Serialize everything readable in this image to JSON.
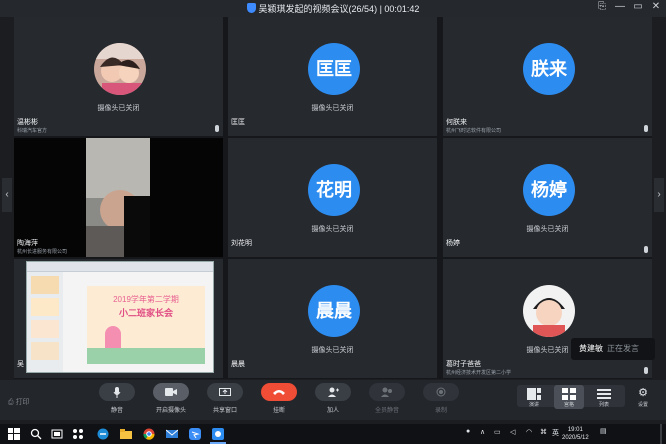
{
  "window": {
    "title": "吴颖琪发起的视频会议(26/54) | 00:01:42",
    "controls": [
      "⎘",
      "—",
      "▭",
      "✕"
    ]
  },
  "participants": [
    {
      "name": "温彬彬",
      "org": "科瑞汽车官方",
      "status": "摄像头已关闭",
      "avatar_type": "photo",
      "mic": true
    },
    {
      "name": "匡匡",
      "org": "",
      "status": "摄像头已关闭",
      "avatar_type": "text",
      "avatar_text": "匡匡",
      "mic": false
    },
    {
      "name": "何朕来",
      "org": "杭州飞时达软件有限公司",
      "status": "",
      "avatar_type": "text",
      "avatar_text": "朕来",
      "mic": true
    },
    {
      "name": "陶海萍",
      "org": "杭州长进服务有限公司",
      "status": "",
      "avatar_type": "video",
      "mic": false
    },
    {
      "name": "刘花明",
      "org": "",
      "status": "摄像头已关闭",
      "avatar_type": "text",
      "avatar_text": "花明",
      "mic": false
    },
    {
      "name": "杨婷",
      "org": "",
      "status": "摄像头已关闭",
      "avatar_type": "text",
      "avatar_text": "杨婷",
      "mic": true
    },
    {
      "name": "吴",
      "org": "",
      "status": "",
      "avatar_type": "share",
      "mic": false
    },
    {
      "name": "晨晨",
      "org": "",
      "status": "摄像头已关闭",
      "avatar_type": "text",
      "avatar_text": "晨晨",
      "mic": false
    },
    {
      "name": "葛时子爸爸",
      "org": "杭州经济技术开发区第二小学",
      "status": "摄像头已关闭",
      "avatar_type": "photo2",
      "mic": true
    }
  ],
  "shared_slide": {
    "line1": "2019学年第二学期",
    "line2": "小二班家长会"
  },
  "speaking_toast": {
    "name": "黄建敏",
    "status": "正在发言"
  },
  "toolbar": {
    "left_label": "打印",
    "buttons": [
      {
        "label": "静音",
        "icon": "microphone-icon"
      },
      {
        "label": "开启摄像头",
        "icon": "camera-icon"
      },
      {
        "label": "共享窗口",
        "icon": "screen-share-icon"
      },
      {
        "label": "挂断",
        "icon": "hangup-icon"
      },
      {
        "label": "加人",
        "icon": "add-person-icon"
      },
      {
        "label": "全员静音",
        "icon": "mute-all-icon"
      },
      {
        "label": "录制",
        "icon": "record-icon"
      }
    ],
    "view_buttons": [
      {
        "label": "演讲",
        "icon": "speaker-view-icon"
      },
      {
        "label": "宫格",
        "icon": "grid-view-icon"
      },
      {
        "label": "列表",
        "icon": "list-view-icon"
      }
    ],
    "settings_label": "设置"
  },
  "taskbar": {
    "ime": "英",
    "time": "19:01",
    "date": "2020/5/12"
  },
  "colors": {
    "avatar_blue": "#2d8cf0",
    "hangup_red": "#f04d36"
  }
}
